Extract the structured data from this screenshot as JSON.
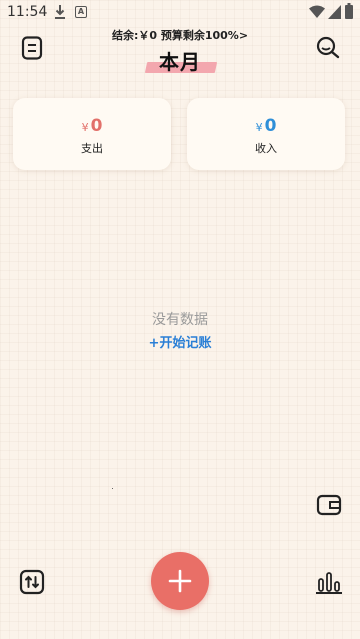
{
  "status_bar": {
    "time": "11:54",
    "icons": [
      "download-icon",
      "a-icon",
      "wifi-icon",
      "signal-icon",
      "battery-icon"
    ]
  },
  "header": {
    "balance_text": "结余:￥0 预算剩余100%>",
    "month_title": "本月",
    "tape_color": "#f3a7ae"
  },
  "summary": {
    "expense": {
      "currency": "¥",
      "amount": "0",
      "label": "支出",
      "color": "#e2706a"
    },
    "income": {
      "currency": "¥",
      "amount": "0",
      "label": "收入",
      "color": "#2f8fd8"
    }
  },
  "empty_state": {
    "message": "没有数据",
    "action": "+开始记账"
  },
  "colors": {
    "background": "#fbf3ea",
    "fab": "#e96f67",
    "link": "#2a7fd6"
  },
  "icons": {
    "menu": "menu-icon",
    "search": "search-icon",
    "wallet": "wallet-icon",
    "sort": "sort-icon",
    "chart": "chart-icon",
    "add": "add-icon"
  }
}
